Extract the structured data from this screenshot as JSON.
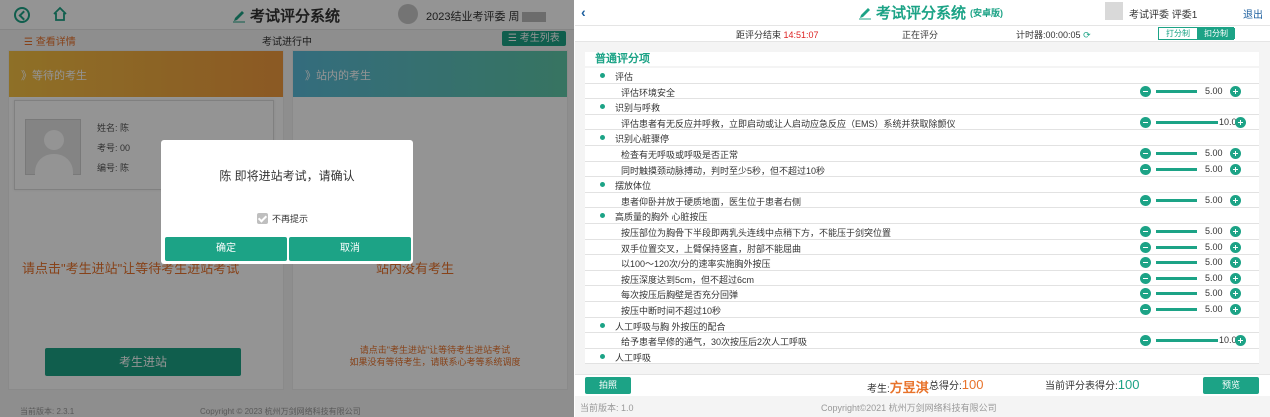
{
  "left": {
    "title": "考试评分系统",
    "user_label": "2023结业考评委 周",
    "detail_link": "查看详情",
    "exam_status": "考试进行中",
    "student_list_btn": "考生列表",
    "waiting_title": "》等待的考生",
    "inside_title": "》站内的考生",
    "student": {
      "name_label": "姓名: 陈",
      "exam_no_label": "考号: 00",
      "number_label": "编号: 陈"
    },
    "hint_left": "请点击\"考生进站\"让等待考生进站考试",
    "hint_right": "站内没有考生",
    "enter_btn": "考生进站",
    "hint_small": "请点击\"考生进站\"让等待考生进站考试\n如果没有等待考生，请联系心考等系统调度",
    "version": "当前版本: 2.3.1",
    "copyright": "Copyright © 2023 杭州万剑网络科技有限公司",
    "dialog": {
      "message": "陈 即将进站考试，请确认",
      "checkbox_label": "不再提示",
      "confirm": "确定",
      "cancel": "取消"
    }
  },
  "right": {
    "title": "考试评分系统",
    "title_suffix": "(安卓版)",
    "user": "考试评委  评委1",
    "exit": "退出",
    "countdown_label": "距评分结束",
    "countdown_value": "14:51:07",
    "status": "正在评分",
    "timer": "计时器:00:00:05",
    "seg_a": "打分制",
    "seg_b": "扣分制",
    "section": "普通评分项",
    "rows": [
      {
        "type": "cat",
        "text": "评估"
      },
      {
        "type": "item",
        "text": "评估环境安全",
        "value": "5.00"
      },
      {
        "type": "cat",
        "text": "识别与呼救"
      },
      {
        "type": "item",
        "text": "评估患者有无反应并呼救，立即启动或让人启动应急反应（EMS）系统并获取除颤仪",
        "value": "10.00",
        "long": true
      },
      {
        "type": "cat",
        "text": "识别心脏骤停"
      },
      {
        "type": "item",
        "text": "检查有无呼吸或呼吸是否正常",
        "value": "5.00"
      },
      {
        "type": "item",
        "text": "同时触摸颈动脉搏动，判时至少5秒，但不超过10秒",
        "value": "5.00"
      },
      {
        "type": "cat",
        "text": "摆放体位"
      },
      {
        "type": "item",
        "text": "患者仰卧并放于硬质地面，医生位于患者右侧",
        "value": "5.00"
      },
      {
        "type": "cat",
        "text": "高质量的胸外 心脏按压"
      },
      {
        "type": "item",
        "text": "按压部位为胸骨下半段即两乳头连线中点稍下方，不能压于剑突位置",
        "value": "5.00"
      },
      {
        "type": "item",
        "text": "双手位置交叉，上臂保持竖直，肘部不能屈曲",
        "value": "5.00"
      },
      {
        "type": "item",
        "text": "以100～120次/分的速率实施胸外按压",
        "value": "5.00"
      },
      {
        "type": "item",
        "text": "按压深度达到5cm，但不超过6cm",
        "value": "5.00"
      },
      {
        "type": "item",
        "text": "每次按压后胸壁是否充分回弹",
        "value": "5.00"
      },
      {
        "type": "item",
        "text": "按压中断时间不超过10秒",
        "value": "5.00"
      },
      {
        "type": "cat",
        "text": "人工呼吸与胸 外按压的配合"
      },
      {
        "type": "item",
        "text": "给予患者早修的通气，30次按压后2次人工呼吸",
        "value": "10.00",
        "long": true
      },
      {
        "type": "cat",
        "text": "人工呼吸"
      }
    ],
    "photo_btn": "拍照",
    "student_label": "考生:",
    "student_name": "方昱淇",
    "total_label": "总得分:",
    "total_value": "100",
    "current_label": "当前评分表得分:",
    "current_value": "100",
    "preview_btn": "预览",
    "version": "当前版本: 1.0",
    "copyright": "Copyright©2021 杭州万剑网络科技有限公司"
  },
  "colors": {
    "accent": "#1ca386",
    "orange": "#e8732b",
    "red": "#dd2222"
  }
}
